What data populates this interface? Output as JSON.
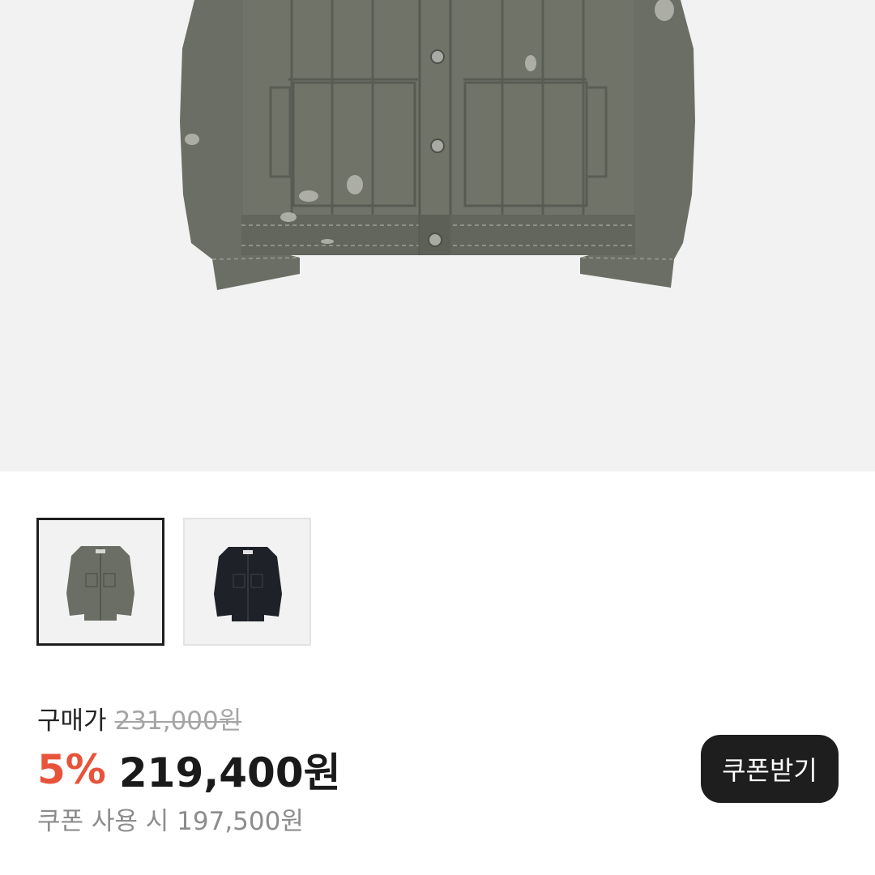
{
  "hero_image": {
    "alt_icon": "jacket-image",
    "colors": {
      "background": "#f2f2f2",
      "jacket": "#6b6e64",
      "jacket_dark": "#565950",
      "stitch": "#8f9187",
      "button": "#9a9a94"
    }
  },
  "thumbnails": [
    {
      "icon": "olive-jacket-thumbnail",
      "color": "#6b6e64",
      "selected": true
    },
    {
      "icon": "black-jacket-thumbnail",
      "color": "#1f2128",
      "selected": false
    }
  ],
  "price": {
    "label": "구매가",
    "original": "231,000원",
    "discount_rate": "5%",
    "sale": "219,400원",
    "coupon_text": "쿠폰 사용 시 197,500원"
  },
  "coupon_button": {
    "label": "쿠폰받기"
  },
  "colors": {
    "discount": "#e8533b",
    "strike": "#a5a5a5",
    "button_bg": "#1e1e1e",
    "button_text": "#ffffff"
  }
}
